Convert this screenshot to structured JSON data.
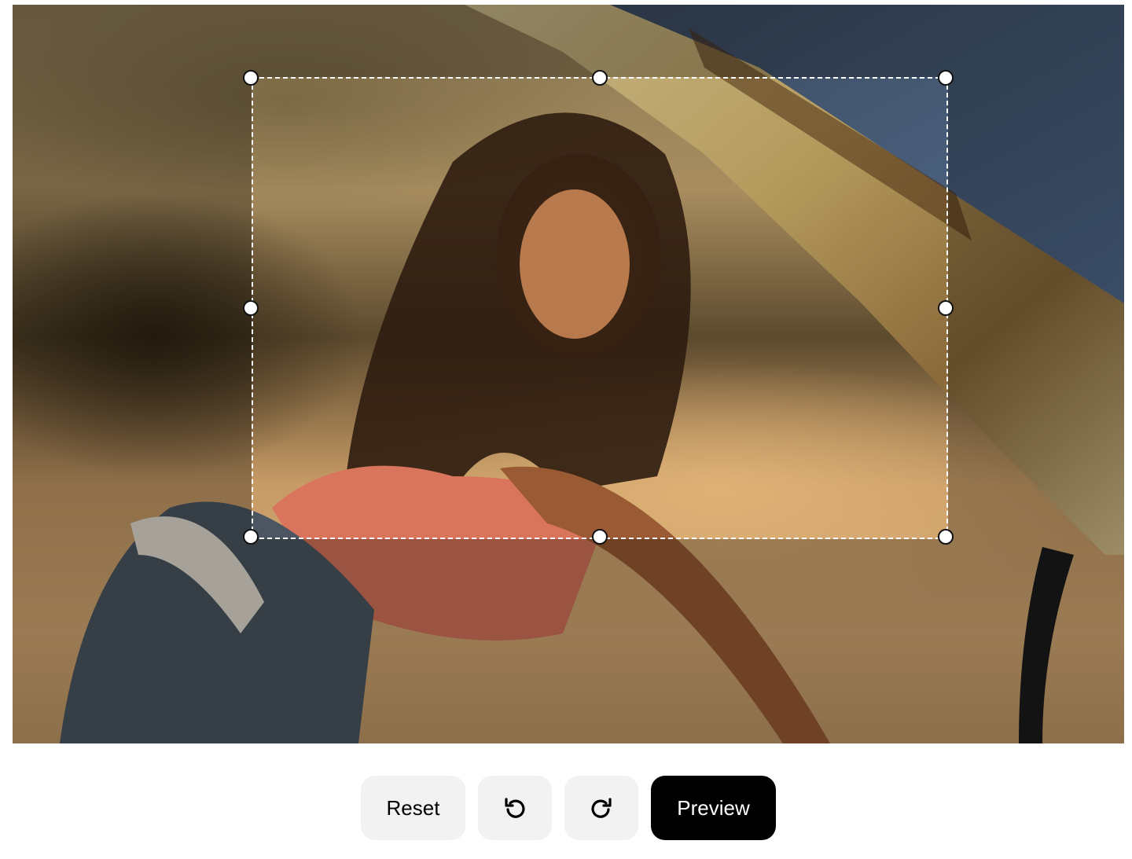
{
  "canvas": {
    "image_description_icon": "photo-icon"
  },
  "toolbar": {
    "reset_label": "Reset",
    "rotate_left_icon": "rotate-left-icon",
    "rotate_right_icon": "rotate-right-icon",
    "preview_label": "Preview"
  },
  "colors": {
    "primary_button_bg": "#000000",
    "primary_button_text": "#ffffff",
    "secondary_button_bg": "#f2f2f2",
    "crop_border": "#ffffff"
  }
}
